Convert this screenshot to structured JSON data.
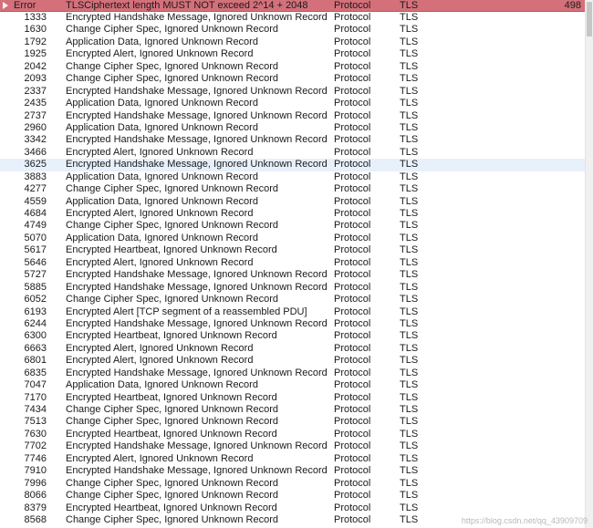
{
  "header": {
    "status": "Error",
    "summary": "TLSCiphertext length MUST NOT exceed 2^14 + 2048",
    "group": "Protocol",
    "protocol": "TLS",
    "count": "498"
  },
  "selected_index": 13,
  "rows": [
    {
      "frame": "1333",
      "summary": "Encrypted Handshake Message, Ignored Unknown Record",
      "group": "Protocol",
      "protocol": "TLS"
    },
    {
      "frame": "1630",
      "summary": "Change Cipher Spec, Ignored Unknown Record",
      "group": "Protocol",
      "protocol": "TLS"
    },
    {
      "frame": "1792",
      "summary": "Application Data, Ignored Unknown Record",
      "group": "Protocol",
      "protocol": "TLS"
    },
    {
      "frame": "1925",
      "summary": "Encrypted Alert, Ignored Unknown Record",
      "group": "Protocol",
      "protocol": "TLS"
    },
    {
      "frame": "2042",
      "summary": "Change Cipher Spec, Ignored Unknown Record",
      "group": "Protocol",
      "protocol": "TLS"
    },
    {
      "frame": "2093",
      "summary": "Change Cipher Spec, Ignored Unknown Record",
      "group": "Protocol",
      "protocol": "TLS"
    },
    {
      "frame": "2337",
      "summary": "Encrypted Handshake Message, Ignored Unknown Record",
      "group": "Protocol",
      "protocol": "TLS"
    },
    {
      "frame": "2435",
      "summary": "Application Data, Ignored Unknown Record",
      "group": "Protocol",
      "protocol": "TLS"
    },
    {
      "frame": "2737",
      "summary": "Encrypted Handshake Message, Ignored Unknown Record",
      "group": "Protocol",
      "protocol": "TLS"
    },
    {
      "frame": "2960",
      "summary": "Application Data, Ignored Unknown Record",
      "group": "Protocol",
      "protocol": "TLS"
    },
    {
      "frame": "3342",
      "summary": "Encrypted Handshake Message, Ignored Unknown Record",
      "group": "Protocol",
      "protocol": "TLS"
    },
    {
      "frame": "3466",
      "summary": "Encrypted Alert, Ignored Unknown Record",
      "group": "Protocol",
      "protocol": "TLS"
    },
    {
      "frame": "3625",
      "summary": "Encrypted Handshake Message, Ignored Unknown Record",
      "group": "Protocol",
      "protocol": "TLS"
    },
    {
      "frame": "3883",
      "summary": "Application Data, Ignored Unknown Record",
      "group": "Protocol",
      "protocol": "TLS"
    },
    {
      "frame": "4277",
      "summary": "Change Cipher Spec, Ignored Unknown Record",
      "group": "Protocol",
      "protocol": "TLS"
    },
    {
      "frame": "4559",
      "summary": "Application Data, Ignored Unknown Record",
      "group": "Protocol",
      "protocol": "TLS"
    },
    {
      "frame": "4684",
      "summary": "Encrypted Alert, Ignored Unknown Record",
      "group": "Protocol",
      "protocol": "TLS"
    },
    {
      "frame": "4749",
      "summary": "Change Cipher Spec, Ignored Unknown Record",
      "group": "Protocol",
      "protocol": "TLS"
    },
    {
      "frame": "5070",
      "summary": "Application Data, Ignored Unknown Record",
      "group": "Protocol",
      "protocol": "TLS"
    },
    {
      "frame": "5617",
      "summary": "Encrypted Heartbeat, Ignored Unknown Record",
      "group": "Protocol",
      "protocol": "TLS"
    },
    {
      "frame": "5646",
      "summary": "Encrypted Alert, Ignored Unknown Record",
      "group": "Protocol",
      "protocol": "TLS"
    },
    {
      "frame": "5727",
      "summary": "Encrypted Handshake Message, Ignored Unknown Record",
      "group": "Protocol",
      "protocol": "TLS"
    },
    {
      "frame": "5885",
      "summary": "Encrypted Handshake Message, Ignored Unknown Record",
      "group": "Protocol",
      "protocol": "TLS"
    },
    {
      "frame": "6052",
      "summary": "Change Cipher Spec, Ignored Unknown Record",
      "group": "Protocol",
      "protocol": "TLS"
    },
    {
      "frame": "6193",
      "summary": "Encrypted Alert [TCP segment of a reassembled PDU]",
      "group": "Protocol",
      "protocol": "TLS"
    },
    {
      "frame": "6244",
      "summary": "Encrypted Handshake Message, Ignored Unknown Record",
      "group": "Protocol",
      "protocol": "TLS"
    },
    {
      "frame": "6300",
      "summary": "Encrypted Heartbeat, Ignored Unknown Record",
      "group": "Protocol",
      "protocol": "TLS"
    },
    {
      "frame": "6663",
      "summary": "Encrypted Alert, Ignored Unknown Record",
      "group": "Protocol",
      "protocol": "TLS"
    },
    {
      "frame": "6801",
      "summary": "Encrypted Alert, Ignored Unknown Record",
      "group": "Protocol",
      "protocol": "TLS"
    },
    {
      "frame": "6835",
      "summary": "Encrypted Handshake Message, Ignored Unknown Record",
      "group": "Protocol",
      "protocol": "TLS"
    },
    {
      "frame": "7047",
      "summary": "Application Data, Ignored Unknown Record",
      "group": "Protocol",
      "protocol": "TLS"
    },
    {
      "frame": "7170",
      "summary": "Encrypted Heartbeat, Ignored Unknown Record",
      "group": "Protocol",
      "protocol": "TLS"
    },
    {
      "frame": "7434",
      "summary": "Change Cipher Spec, Ignored Unknown Record",
      "group": "Protocol",
      "protocol": "TLS"
    },
    {
      "frame": "7513",
      "summary": "Change Cipher Spec, Ignored Unknown Record",
      "group": "Protocol",
      "protocol": "TLS"
    },
    {
      "frame": "7630",
      "summary": "Encrypted Heartbeat, Ignored Unknown Record",
      "group": "Protocol",
      "protocol": "TLS"
    },
    {
      "frame": "7702",
      "summary": "Encrypted Handshake Message, Ignored Unknown Record",
      "group": "Protocol",
      "protocol": "TLS"
    },
    {
      "frame": "7746",
      "summary": "Encrypted Alert, Ignored Unknown Record",
      "group": "Protocol",
      "protocol": "TLS"
    },
    {
      "frame": "7910",
      "summary": "Encrypted Handshake Message, Ignored Unknown Record",
      "group": "Protocol",
      "protocol": "TLS"
    },
    {
      "frame": "7996",
      "summary": "Change Cipher Spec, Ignored Unknown Record",
      "group": "Protocol",
      "protocol": "TLS"
    },
    {
      "frame": "8066",
      "summary": "Change Cipher Spec, Ignored Unknown Record",
      "group": "Protocol",
      "protocol": "TLS"
    },
    {
      "frame": "8379",
      "summary": "Encrypted Heartbeat, Ignored Unknown Record",
      "group": "Protocol",
      "protocol": "TLS"
    },
    {
      "frame": "8568",
      "summary": "Change Cipher Spec, Ignored Unknown Record",
      "group": "Protocol",
      "protocol": "TLS"
    }
  ],
  "watermark": "https://blog.csdn.net/qq_43909709",
  "colors": {
    "error_row_bg": "#d4707a",
    "selected_row_bg": "#e8f1fb"
  }
}
